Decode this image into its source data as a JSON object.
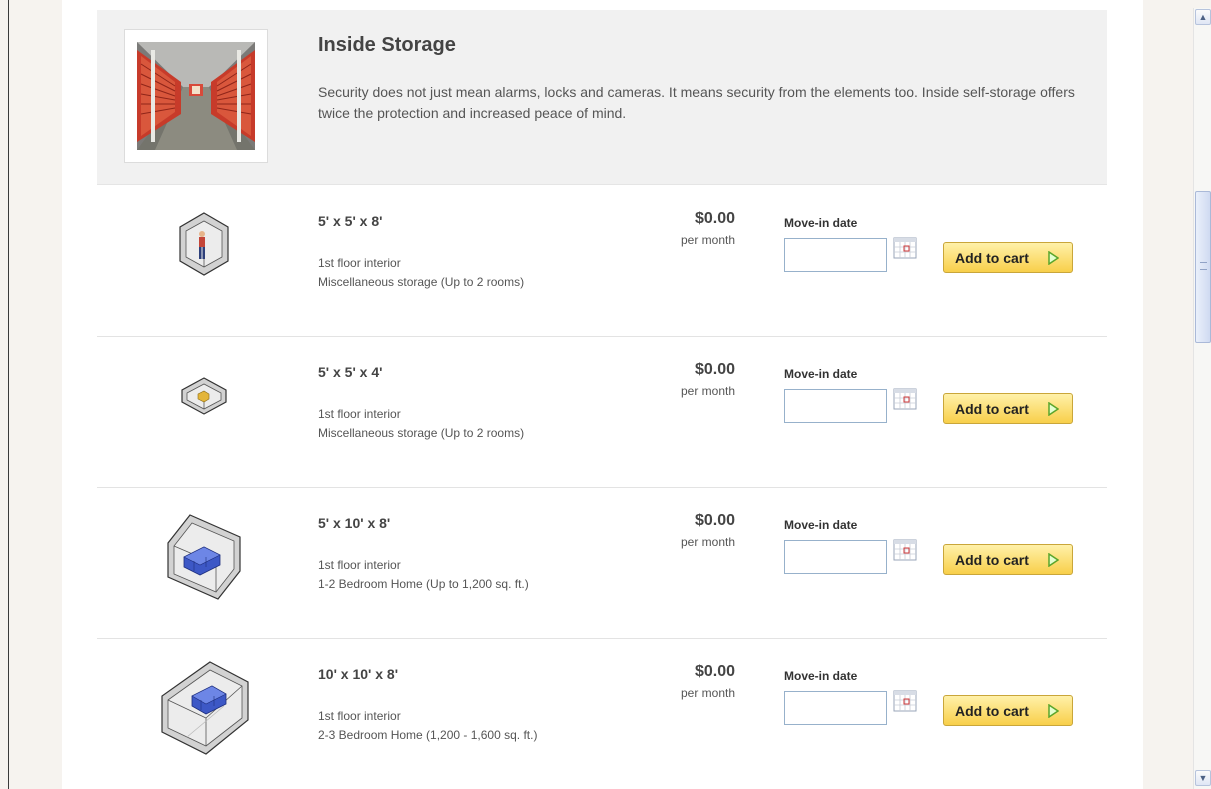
{
  "section": {
    "title": "Inside Storage",
    "description": "Security does not just mean alarms, locks and cameras. It means security from the elements too. Inside self-storage offers twice the protection and increased peace of mind."
  },
  "units": [
    {
      "size": "5' x 5' x 8'",
      "floor": "1st floor interior",
      "description": "Miscellaneous storage (Up to 2 rooms)",
      "price": "$0.00",
      "period": "per month",
      "movein_label": "Move-in date",
      "movein_value": "",
      "cart_label": "Add to cart",
      "icon": "storage-unit-5x5x8-icon"
    },
    {
      "size": "5' x 5' x 4'",
      "floor": "1st floor interior",
      "description": "Miscellaneous storage (Up to 2 rooms)",
      "price": "$0.00",
      "period": "per month",
      "movein_label": "Move-in date",
      "movein_value": "",
      "cart_label": "Add to cart",
      "icon": "storage-unit-5x5x4-icon"
    },
    {
      "size": "5' x 10' x 8'",
      "floor": "1st floor interior",
      "description": "1-2 Bedroom Home (Up to 1,200 sq. ft.)",
      "price": "$0.00",
      "period": "per month",
      "movein_label": "Move-in date",
      "movein_value": "",
      "cart_label": "Add to cart",
      "icon": "storage-unit-5x10x8-icon"
    },
    {
      "size": "10' x 10' x 8'",
      "floor": "1st floor interior",
      "description": "2-3 Bedroom Home (1,200 - 1,600 sq. ft.)",
      "price": "$0.00",
      "period": "per month",
      "movein_label": "Move-in date",
      "movein_value": "",
      "cart_label": "Add to cart",
      "icon": "storage-unit-10x10x8-icon"
    }
  ],
  "colors": {
    "button_gradient_top": "#fff1a9",
    "button_gradient_bottom": "#f8cf4a",
    "arrow_green": "#5aa52c",
    "header_background": "#f1f1f1",
    "page_background": "#f6f3ef"
  }
}
